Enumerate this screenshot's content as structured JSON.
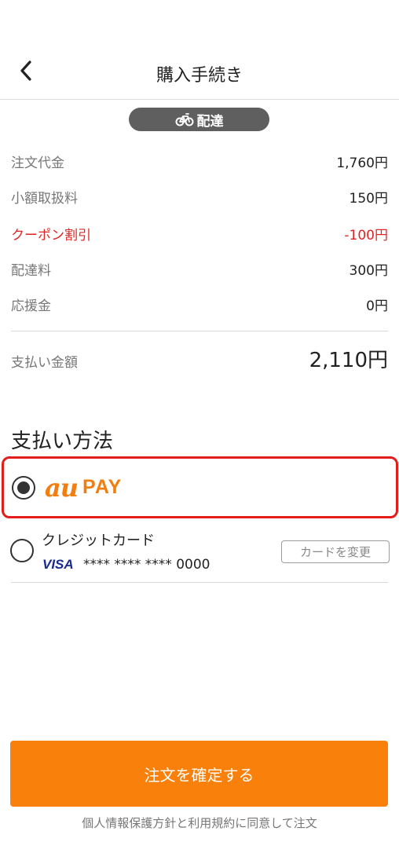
{
  "header": {
    "title": "購入手続き"
  },
  "delivery_badge": {
    "label": "配達"
  },
  "summary": {
    "items": [
      {
        "label": "注文代金",
        "value": "1,760円"
      },
      {
        "label": "小額取扱料",
        "value": "150円"
      },
      {
        "label": "クーポン割引",
        "value": "-100円"
      },
      {
        "label": "配達料",
        "value": "300円"
      },
      {
        "label": "応援金",
        "value": "0円"
      }
    ],
    "total": {
      "label": "支払い金額",
      "value": "2,110円"
    }
  },
  "payment": {
    "title": "支払い方法",
    "au_pay": {
      "logo_au": "au",
      "logo_pay": "PAY",
      "selected": true
    },
    "credit_card": {
      "label": "クレジットカード",
      "brand": "VISA",
      "number": "**** **** **** 0000",
      "change_label": "カードを変更",
      "selected": false
    }
  },
  "actions": {
    "confirm_label": "注文を確定する"
  },
  "footer": {
    "note": "個人情報保護方針と利用規約に同意して注文"
  },
  "colors": {
    "accent": "#f8800b",
    "danger": "#e02424",
    "selected_border": "#e31c1c",
    "visa": "#1a2a8f"
  }
}
